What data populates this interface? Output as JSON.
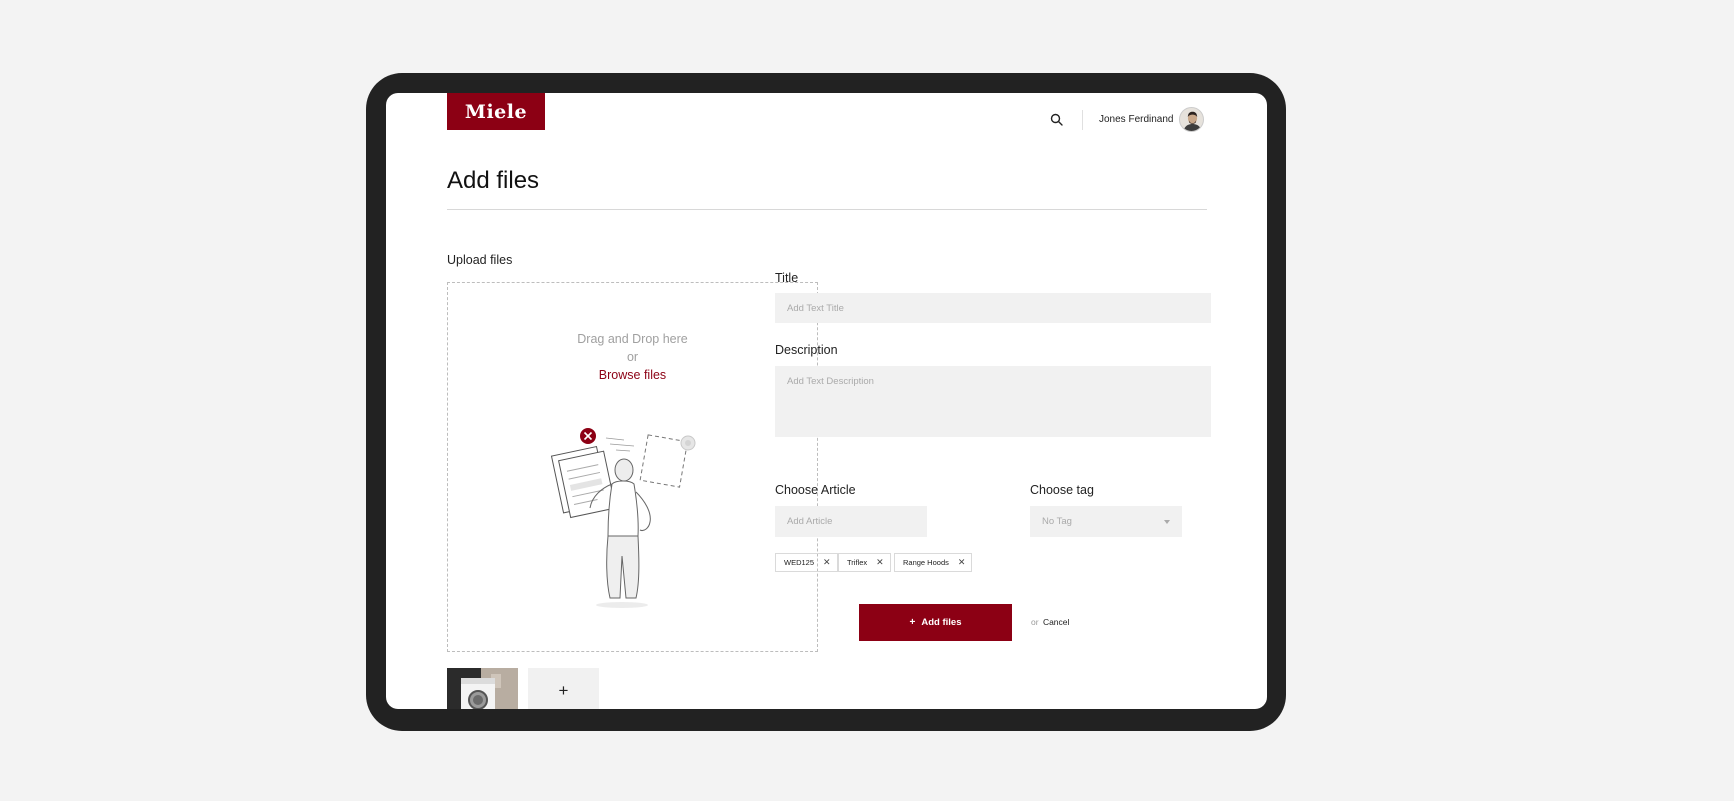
{
  "brand": {
    "logo_text": "Miele",
    "accent": "#8c0014"
  },
  "header": {
    "user_name": "Jones Ferdinand",
    "search_icon": "search-icon"
  },
  "page": {
    "title": "Add files"
  },
  "upload": {
    "label": "Upload files",
    "drag_text": "Drag and Drop here",
    "or_text": "or",
    "browse_text": "Browse files"
  },
  "form": {
    "title_label": "Title",
    "title_placeholder": "Add Text Title",
    "description_label": "Description",
    "description_placeholder": "Add Text Description",
    "article_label": "Choose Article",
    "article_placeholder": "Add Article",
    "tag_label": "Choose tag",
    "tag_value": "No Tag"
  },
  "chips": [
    {
      "label": "WED125"
    },
    {
      "label": "Triflex"
    },
    {
      "label": "Range Hoods"
    }
  ],
  "actions": {
    "add_plus": "+",
    "add_label": "Add files",
    "or_text": "or",
    "cancel_label": "Cancel"
  },
  "thumbnails": {
    "add_label": "+"
  }
}
